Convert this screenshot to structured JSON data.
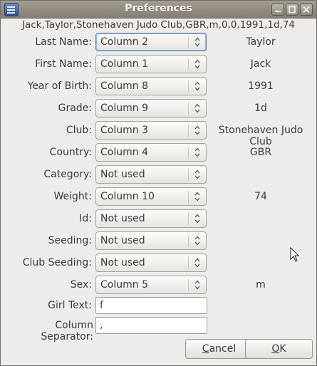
{
  "window": {
    "title": "Preferences"
  },
  "header": {
    "sample_line": "Jack,Taylor,Stonehaven Judo Club,GBR,m,0,0,1991,1d,74"
  },
  "fields": [
    {
      "label": "Last Name:",
      "selected": "Column 2",
      "preview": "Taylor",
      "focused": true
    },
    {
      "label": "First Name:",
      "selected": "Column 1",
      "preview": "Jack"
    },
    {
      "label": "Year of Birth:",
      "selected": "Column 8",
      "preview": "1991"
    },
    {
      "label": "Grade:",
      "selected": "Column 9",
      "preview": "1d"
    },
    {
      "label": "Club:",
      "selected": "Column 3",
      "preview": "Stonehaven Judo Club"
    },
    {
      "label": "Country:",
      "selected": "Column 4",
      "preview": "GBR"
    },
    {
      "label": "Category:",
      "selected": "Not used",
      "preview": ""
    },
    {
      "label": "Weight:",
      "selected": "Column 10",
      "preview": "74"
    },
    {
      "label": "Id:",
      "selected": "Not used",
      "preview": ""
    },
    {
      "label": "Seeding:",
      "selected": "Not used",
      "preview": ""
    },
    {
      "label": "Club Seeding:",
      "selected": "Not used",
      "preview": ""
    },
    {
      "label": "Sex:",
      "selected": "Column 5",
      "preview": "m"
    }
  ],
  "girl_text": {
    "label": "Girl Text:",
    "value": "f"
  },
  "column_separator": {
    "label": "Column Separator:",
    "value": ","
  },
  "buttons": {
    "cancel": "Cancel",
    "ok": "OK"
  },
  "icons": {
    "app": "app-icon",
    "minimize": "minimize-icon",
    "maximize": "maximize-icon",
    "close": "close-icon",
    "combo_arrows": "updown-arrows-icon",
    "cursor": "mouse-pointer-icon"
  },
  "colors": {
    "titlebar": "#948e84",
    "focus_border": "#5e7fae",
    "background": "#edeceb"
  }
}
